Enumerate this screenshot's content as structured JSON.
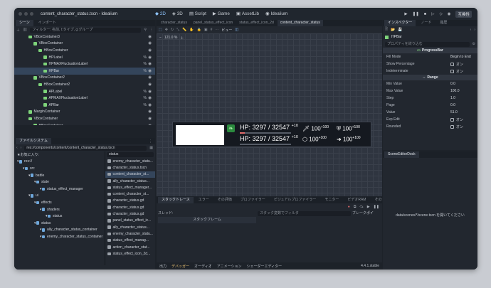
{
  "window": {
    "title": "content_character_status.tscn - Idealium"
  },
  "workspaces": [
    {
      "label": "2D",
      "active": true,
      "icon": "2d-icon"
    },
    {
      "label": "3D",
      "active": false,
      "icon": "3d-icon"
    },
    {
      "label": "Script",
      "active": false,
      "icon": "script-icon"
    },
    {
      "label": "Game",
      "active": false,
      "icon": "game-icon"
    },
    {
      "label": "AssetLib",
      "active": false,
      "icon": "assetlib-icon"
    },
    {
      "label": "Idealium",
      "active": false,
      "icon": "idealium-icon"
    }
  ],
  "run_mode_label": "互換性",
  "scene_panel": {
    "tabs": [
      "シーン",
      "インポート"
    ],
    "filter_placeholder": "フィルター: 名前, t:タイプ, g:グループ",
    "nodes": [
      {
        "name": "VBoxContainer3",
        "depth": 2,
        "icon": "green",
        "pct": false
      },
      {
        "name": "VBoxContainer",
        "depth": 3,
        "icon": "green",
        "pct": false
      },
      {
        "name": "HBoxContainer",
        "depth": 4,
        "icon": "green",
        "pct": false
      },
      {
        "name": "HPLabel",
        "depth": 5,
        "icon": "green",
        "pct": true
      },
      {
        "name": "HPMAXFluctuationLabel",
        "depth": 5,
        "icon": "green",
        "pct": true
      },
      {
        "name": "HPBar",
        "depth": 5,
        "icon": "green",
        "pct": true,
        "selected": true
      },
      {
        "name": "VBoxContainer2",
        "depth": 3,
        "icon": "green",
        "pct": false
      },
      {
        "name": "HBoxContainer2",
        "depth": 4,
        "icon": "green",
        "pct": false
      },
      {
        "name": "APLabel",
        "depth": 5,
        "icon": "green",
        "pct": true
      },
      {
        "name": "APMAXFluctuationLabel",
        "depth": 5,
        "icon": "green",
        "pct": true
      },
      {
        "name": "APBar",
        "depth": 5,
        "icon": "green",
        "pct": true
      },
      {
        "name": "MarginContainer",
        "depth": 2,
        "icon": "green",
        "pct": false
      },
      {
        "name": "VBoxContainer",
        "depth": 2,
        "icon": "green",
        "pct": false
      },
      {
        "name": "HBoxContainer",
        "depth": 3,
        "icon": "green",
        "pct": false
      }
    ]
  },
  "filesystem": {
    "title": "ファイルシステム",
    "path": "res://components/content/content_character_status.tscn",
    "favorites": "お気に入り:",
    "search_value": "status",
    "tree": [
      {
        "name": "res://",
        "depth": 0
      },
      {
        "name": "src",
        "depth": 1
      },
      {
        "name": "battle",
        "depth": 2
      },
      {
        "name": "state",
        "depth": 3
      },
      {
        "name": "status_effect_manager",
        "depth": 4
      },
      {
        "name": "ui",
        "depth": 2
      },
      {
        "name": "effects",
        "depth": 3
      },
      {
        "name": "shaders",
        "depth": 4
      },
      {
        "name": "status",
        "depth": 5
      },
      {
        "name": "status",
        "depth": 3
      },
      {
        "name": "ally_character_status_container",
        "depth": 4
      },
      {
        "name": "enemy_character_status_container",
        "depth": 4
      }
    ],
    "files": [
      "enemy_character_statu...",
      "character_status.tscn",
      "content_character_st...",
      "ally_character_status...",
      "status_effect_manager...",
      "content_character_st...",
      "character_status.gd",
      "character_status.gd",
      "character_status.gd",
      "panel_status_effect_ic...",
      "ally_character_status...",
      "enemy_character_statu...",
      "status_effect_manag...",
      "action_character_stat...",
      "status_effect_icon_2d..."
    ],
    "selected_file_index": 2
  },
  "editor": {
    "tabs": [
      "character_status",
      "panel_status_effect_icon",
      "status_effect_icon_2d",
      "content_character_status"
    ],
    "active_tab_index": 3,
    "view_label": "ビュー",
    "zoom": "121.0 %",
    "hp_text": "HP: 3297 / 32547",
    "hp_delta": "+10",
    "hp_text2": "HP: 3297 / 32547",
    "hp_delta2": "+10",
    "hp_fill": 0.1,
    "stats": [
      {
        "icon": "sword-icon",
        "value": "100",
        "delta": "+100"
      },
      {
        "icon": "shield-icon",
        "value": "100",
        "delta": "+100"
      },
      {
        "icon": "hex-icon",
        "value": "100",
        "delta": "+100"
      },
      {
        "icon": "arrow-icon",
        "value": "100",
        "delta": "+100"
      }
    ]
  },
  "bottom": {
    "tabs": [
      "スタックトレース",
      "エラー",
      "その評価",
      "プロファイラー",
      "ビジュアルプロファイラー",
      "モニター",
      "ビデオRAM",
      "その他"
    ],
    "thread_label": "スレッド:",
    "stack_frame": "スタックフレーム",
    "filter_placeholder": "スタック変数でフィルタ",
    "breakpoints": "ブレークポイ",
    "footer": [
      "出力",
      "デバッガー",
      "オーディオ",
      "アニメーション",
      "シェーダーエディター"
    ],
    "version": "4.4.1.stable"
  },
  "inspector": {
    "tabs": [
      "インスペクター",
      "ノード",
      "履歴"
    ],
    "node_name": "HPBar",
    "filter_placeholder": "プロパティを絞り込む",
    "class_name": "ProgressBar",
    "props1": [
      {
        "label": "Fill Mode",
        "value": "Begin to End"
      },
      {
        "label": "Show Percentage",
        "value": "オン"
      },
      {
        "label": "Indeterminate",
        "value": "オン"
      }
    ],
    "range_section": "Range",
    "props2": [
      {
        "label": "Min Value",
        "value": "0.0"
      },
      {
        "label": "Max Value",
        "value": "100.0"
      },
      {
        "label": "Step",
        "value": "1.0"
      },
      {
        "label": "Page",
        "value": "0.0"
      },
      {
        "label": "Value",
        "value": "51.0"
      },
      {
        "label": "Exp Edit",
        "value": "オン"
      },
      {
        "label": "Rounded",
        "value": "オン"
      }
    ],
    "dock_title": "SceneEditorDock",
    "dock_message": "data/scenes/*/scene.tscn を開いてください"
  }
}
